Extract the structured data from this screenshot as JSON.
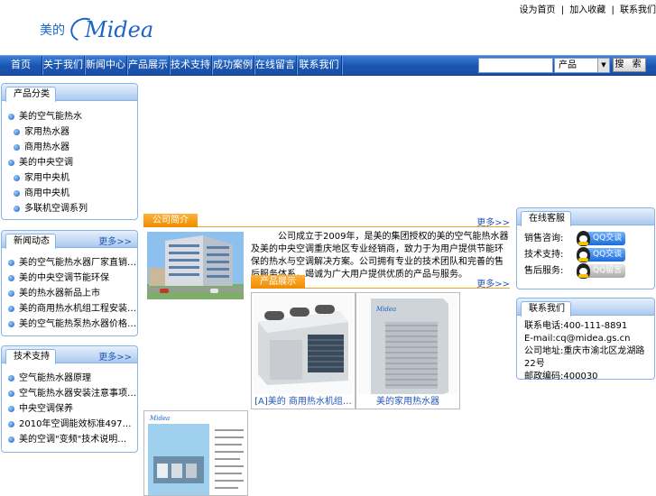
{
  "header": {
    "top_links": [
      "设为首页",
      "加入收藏",
      "联系我们"
    ],
    "top_link_sep": "|",
    "logo_cn": "美的",
    "logo_en": "Midea"
  },
  "nav": {
    "items": [
      "首页",
      "关于我们",
      "新闻中心",
      "产品展示",
      "技术支持",
      "成功案例",
      "在线留言",
      "联系我们"
    ]
  },
  "search": {
    "input_value": "",
    "select_value": "产品",
    "button_label": "搜 索"
  },
  "left": {
    "categories": {
      "title": "产品分类",
      "items": [
        {
          "label": "美的空气能热水",
          "sub": false
        },
        {
          "label": "家用热水器",
          "sub": true
        },
        {
          "label": "商用热水器",
          "sub": true
        },
        {
          "label": "美的中央空调",
          "sub": false
        },
        {
          "label": "家用中央机",
          "sub": true
        },
        {
          "label": "商用中央机",
          "sub": true
        },
        {
          "label": "多联机空调系列",
          "sub": true
        }
      ]
    },
    "news": {
      "title": "新闻动态",
      "more": "更多>>",
      "items": [
        "美的空气能热水器厂家直销…",
        "美的中央空调节能环保",
        "美的热水器新品上市",
        "美的商用热水机组工程安装…",
        "美的空气能热泵热水器价格…"
      ]
    },
    "tech": {
      "title": "技术支持",
      "more": "更多>>",
      "items": [
        "空气能热水器原理",
        "空气能热水器安装注意事项…",
        "中央空调保养",
        "2010年空调能效标准497…",
        "美的空调\"变频\"技术说明…"
      ]
    }
  },
  "center": {
    "about": {
      "tab": "公司简介",
      "more": "更多>>",
      "text": "公司成立于2009年，是美的集团授权的美的空气能热水器及美的中央空调重庆地区专业经销商，致力于为用户提供节能环保的热水与空调解决方案。公司拥有专业的技术团队和完善的售后服务体系，竭诚为广大用户提供优质的产品与服务。"
    },
    "products": {
      "tab": "产品展示",
      "more": "更多>>",
      "items": [
        {
          "caption": "[A]美的 商用热水机组…"
        },
        {
          "caption": "美的家用热水器"
        }
      ]
    }
  },
  "right": {
    "online": {
      "title": "在线客服",
      "rows": [
        {
          "label": "销售咨询:",
          "btn": "QQ交谈"
        },
        {
          "label": "技术支持:",
          "btn": "QQ交谈"
        },
        {
          "label": "售后服务:",
          "btn": "QQ留言"
        }
      ]
    },
    "contact": {
      "title": "联系我们",
      "lines": [
        "联系电话:400-111-8891",
        "E-mail:cq@midea.gs.cn",
        "公司地址:重庆市渝北区龙湖路22号",
        "邮政编码:400030"
      ]
    }
  },
  "colors": {
    "nav_blue": "#1a54b0",
    "accent_orange": "#f08c00",
    "link_blue": "#2457b8",
    "panel_border": "#8ab3e6"
  }
}
